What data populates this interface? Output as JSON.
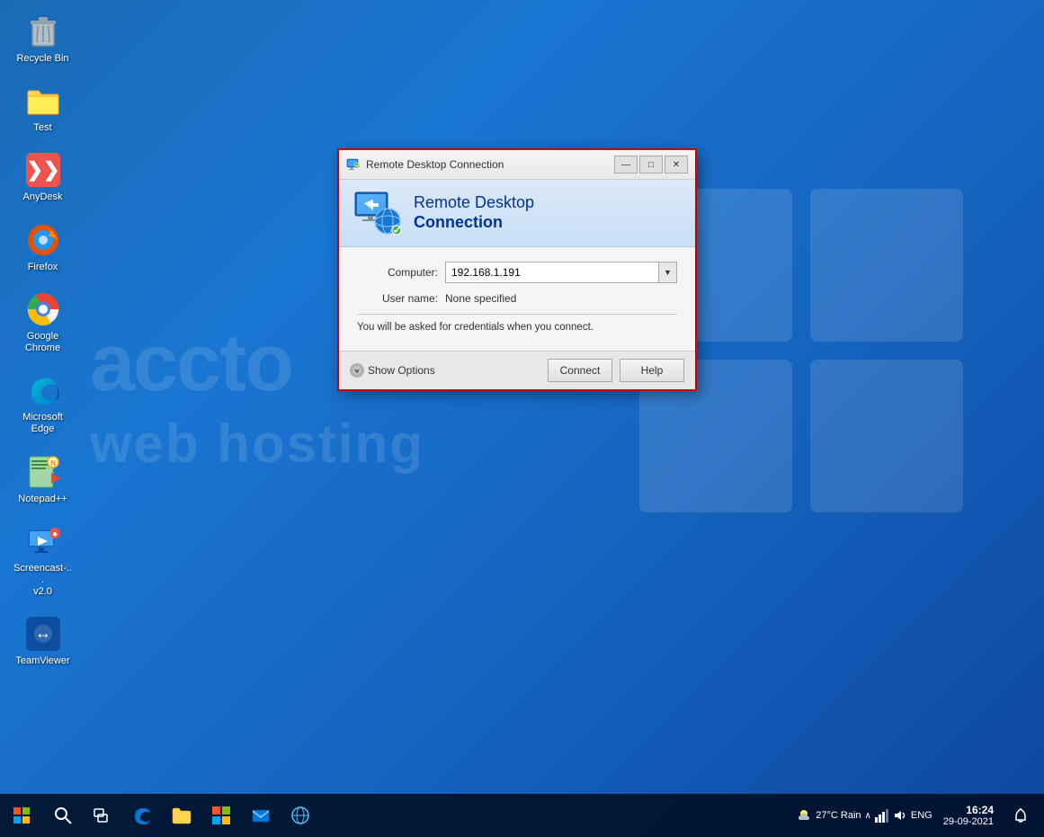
{
  "desktop": {
    "background": "Windows 10 blue gradient",
    "watermark": {
      "line1": "accto",
      "line2": "web hosting"
    }
  },
  "icons": [
    {
      "id": "recycle-bin",
      "label": "Recycle Bin",
      "icon": "🗑️"
    },
    {
      "id": "test",
      "label": "Test",
      "icon": "📁"
    },
    {
      "id": "anydesk",
      "label": "AnyDesk",
      "icon": "❯"
    },
    {
      "id": "firefox",
      "label": "Firefox",
      "icon": "🦊"
    },
    {
      "id": "google-chrome",
      "label": "Google Chrome",
      "icon": "🌐"
    },
    {
      "id": "microsoft-edge",
      "label": "Microsoft Edge",
      "icon": "🌊"
    },
    {
      "id": "notepadpp",
      "label": "Notepad++",
      "icon": "📝"
    },
    {
      "id": "screencast",
      "label": "Screencast-...\nv2.0",
      "icon": "🎬"
    },
    {
      "id": "teamviewer",
      "label": "TeamViewer",
      "icon": "↔"
    }
  ],
  "dialog": {
    "title": "Remote Desktop Connection",
    "header_line1": "Remote Desktop",
    "header_line2": "Connection",
    "computer_label": "Computer:",
    "computer_value": "192.168.1.191",
    "username_label": "User name:",
    "username_value": "None specified",
    "info_text": "You will be asked for credentials when you connect.",
    "show_options_label": "Show Options",
    "connect_button": "Connect",
    "help_button": "Help",
    "minimize_symbol": "—",
    "maximize_symbol": "□",
    "close_symbol": "✕"
  },
  "taskbar": {
    "start_icon": "⊞",
    "search_icon": "○",
    "taskview_icon": "❑",
    "edge_icon": "🌊",
    "explorer_icon": "📁",
    "store_icon": "🛍️",
    "mail_icon": "✉",
    "network_icon": "🌐",
    "weather": "27°C Rain",
    "language": "ENG",
    "time": "16:24",
    "date": "29-09-2021",
    "notification_icon": "🔔",
    "volume_icon": "🔊",
    "network_taskbar": "🔗"
  }
}
